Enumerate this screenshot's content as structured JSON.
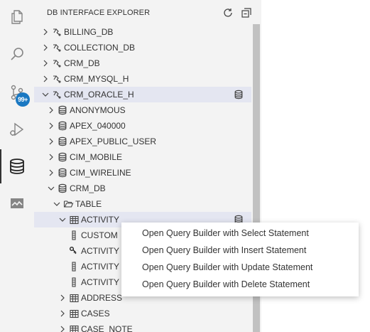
{
  "activity_bar": {
    "items": [
      {
        "name": "explorer",
        "icon": "files-icon"
      },
      {
        "name": "search",
        "icon": "search-icon"
      },
      {
        "name": "source-control",
        "icon": "source-control-icon"
      },
      {
        "name": "run-debug",
        "icon": "run-debug-icon"
      },
      {
        "name": "database",
        "icon": "database-icon",
        "active": true
      },
      {
        "name": "chart",
        "icon": "chart-icon"
      }
    ],
    "badge": "99+"
  },
  "sidebar": {
    "title": "DB INTERFACE EXPLORER",
    "tree": [
      {
        "label": "BILLING_DB",
        "icon": "connection-icon",
        "chevron": "right"
      },
      {
        "label": "COLLECTION_DB",
        "icon": "connection-icon",
        "chevron": "right"
      },
      {
        "label": "CRM_DB",
        "icon": "connection-icon",
        "chevron": "right"
      },
      {
        "label": "CRM_MYSQL_H",
        "icon": "connection-icon",
        "chevron": "right"
      },
      {
        "label": "CRM_ORACLE_H",
        "icon": "connection-icon",
        "chevron": "down",
        "selected": true,
        "end_icon": "database-icon"
      },
      {
        "label": "ANONYMOUS",
        "icon": "database-icon",
        "chevron": "right"
      },
      {
        "label": "APEX_040000",
        "icon": "database-icon",
        "chevron": "right"
      },
      {
        "label": "APEX_PUBLIC_USER",
        "icon": "database-icon",
        "chevron": "right"
      },
      {
        "label": "CIM_MOBILE",
        "icon": "database-icon",
        "chevron": "right"
      },
      {
        "label": "CIM_WIRELINE",
        "icon": "database-icon",
        "chevron": "right"
      },
      {
        "label": "CRM_DB",
        "icon": "database-icon",
        "chevron": "down"
      },
      {
        "label": "TABLE",
        "icon": "folder-open-icon",
        "chevron": "down"
      },
      {
        "label": "ACTIVITY",
        "icon": "table-icon",
        "chevron": "down",
        "hover": true,
        "end_icon": "database-icon"
      },
      {
        "label": "CUSTOM",
        "icon": "column-icon",
        "chevron": "none"
      },
      {
        "label": "ACTIVITY",
        "icon": "key-icon",
        "chevron": "none"
      },
      {
        "label": "ACTIVITY",
        "icon": "column-icon",
        "chevron": "none"
      },
      {
        "label": "ACTIVITY",
        "icon": "column-icon",
        "chevron": "none"
      },
      {
        "label": "ADDRESS",
        "icon": "table-icon",
        "chevron": "right"
      },
      {
        "label": "CASES",
        "icon": "table-icon",
        "chevron": "right"
      },
      {
        "label": "CASE_NOTE",
        "icon": "table-icon",
        "chevron": "right"
      }
    ]
  },
  "context_menu": {
    "items": [
      "Open Query Builder with Select Statement",
      "Open Query Builder with Insert Statement",
      "Open Query Builder with Update Statement",
      "Open Query Builder with Delete Statement"
    ]
  },
  "colors": {
    "activity_bar_bg": "#f3f3f3",
    "sidebar_bg": "#f3f3f3",
    "selection_bg": "#e4e6f1",
    "badge_bg": "#1a78c2",
    "scrollbar": "#c1c1c1"
  }
}
